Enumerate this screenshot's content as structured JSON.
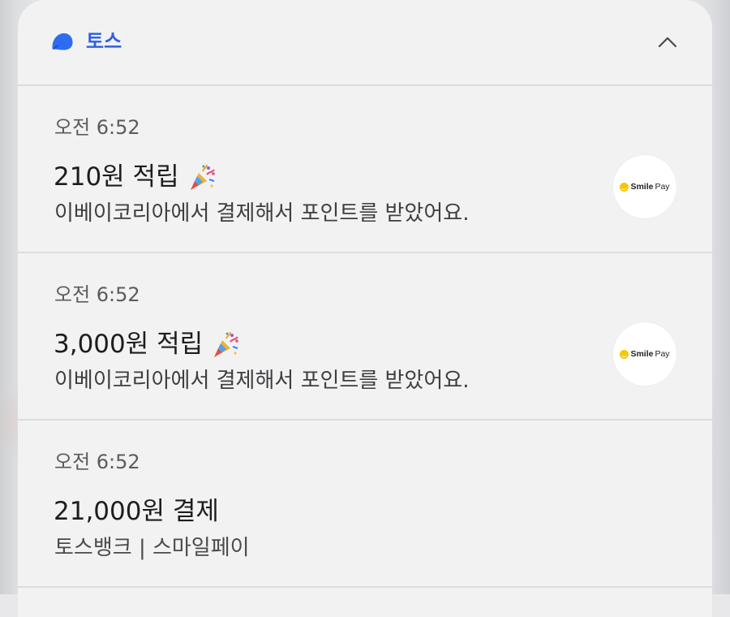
{
  "app": {
    "name": "토스",
    "brand_color": "#2f5fe0",
    "icon": "toss-logo-icon",
    "collapse_icon": "chevron-up-icon"
  },
  "notifications": [
    {
      "time": "오전 6:52",
      "title": "210원 적립",
      "title_emoji": "party-popper-icon",
      "body": "이베이코리아에서 결제해서 포인트를 받았어요.",
      "logo": {
        "name": "smilepay-logo",
        "smile": "Smile",
        "pay": "Pay"
      }
    },
    {
      "time": "오전 6:52",
      "title": "3,000원 적립",
      "title_emoji": "party-popper-icon",
      "body": "이베이코리아에서 결제해서 포인트를 받았어요.",
      "logo": {
        "name": "smilepay-logo",
        "smile": "Smile",
        "pay": "Pay"
      }
    },
    {
      "time": "오전 6:52",
      "title": "21,000원 결제",
      "body": "토스뱅크 | 스마일페이"
    }
  ]
}
